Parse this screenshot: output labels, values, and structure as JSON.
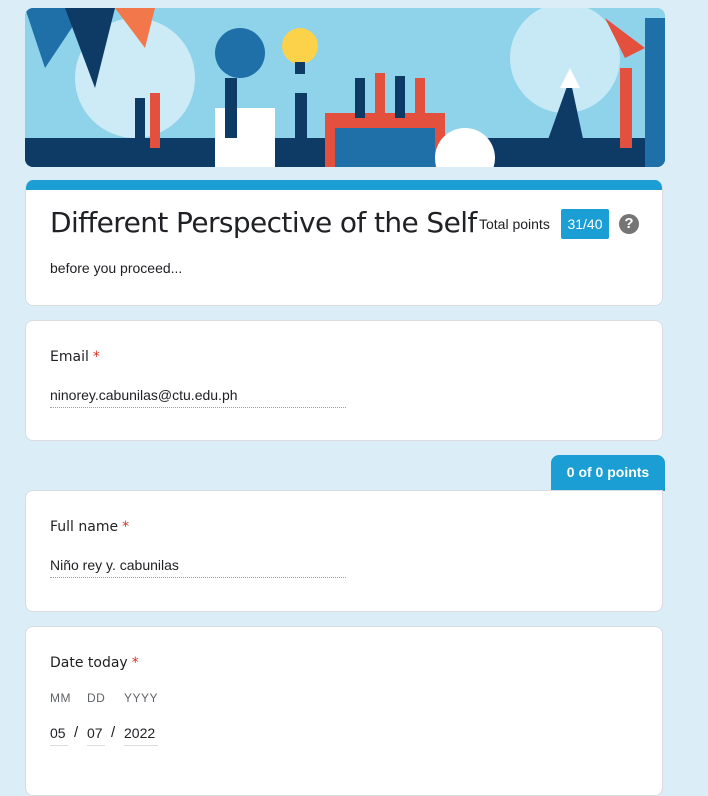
{
  "header": {
    "title": "Different Perspective of the Self",
    "total_points_label": "Total points",
    "score": "31/40",
    "help_glyph": "?",
    "description": "before you proceed..."
  },
  "theme": {
    "accent": "#1a9ed4",
    "required": "#d93025",
    "background": "#dbeef8"
  },
  "questions": {
    "email": {
      "label": "Email",
      "required_mark": "*",
      "value": "ninorey.cabunilas@ctu.edu.ph"
    },
    "section_points": "0 of 0 points",
    "full_name": {
      "label": "Full name",
      "required_mark": "*",
      "value": "Niño rey y. cabunilas"
    },
    "date": {
      "label": "Date today",
      "required_mark": "*",
      "mm_label": "MM",
      "dd_label": "DD",
      "yyyy_label": "YYYY",
      "mm": "05",
      "dd": "07",
      "yyyy": "2022",
      "separator": "/"
    }
  }
}
